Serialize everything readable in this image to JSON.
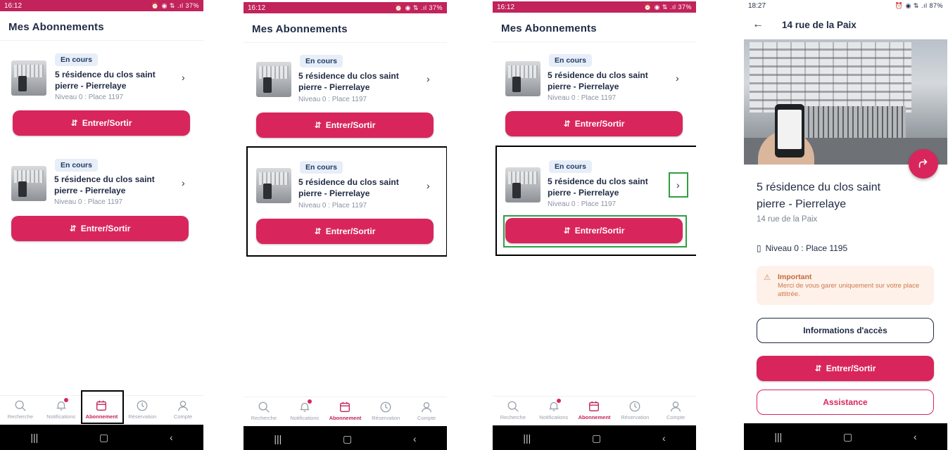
{
  "colors": {
    "brand": "#c1235a",
    "button": "#d8265c",
    "badge_bg": "#e7eef8",
    "text": "#1f2a44",
    "muted": "#8a93a3",
    "warning_bg": "#fdf1ea",
    "highlight_green": "#2f9e44"
  },
  "status_bars": [
    {
      "time": "16:12",
      "battery": "37%"
    },
    {
      "time": "16:12",
      "battery": "37%"
    },
    {
      "time": "16:12",
      "battery": "37%"
    },
    {
      "time": "18:27",
      "battery": "87%"
    }
  ],
  "list_screen": {
    "title": "Mes Abonnements",
    "subscriptions": [
      {
        "status": "En cours",
        "address_line1": "5 résidence du clos saint",
        "address_line2": "pierre - Pierrelaye",
        "place": "Niveau 0 : Place 1197",
        "action": "Entrer/Sortir"
      },
      {
        "status": "En cours",
        "address_line1": "5 résidence du clos saint",
        "address_line2": "pierre - Pierrelaye",
        "place": "Niveau 0 : Place 1197",
        "action": "Entrer/Sortir"
      }
    ]
  },
  "bottom_nav": [
    {
      "label": "Recherche",
      "icon": "search-icon"
    },
    {
      "label": "Notifications",
      "icon": "bell-icon",
      "dot": true
    },
    {
      "label": "Abonnement",
      "icon": "calendar-icon",
      "active": true
    },
    {
      "label": "Réservation",
      "icon": "clock-icon"
    },
    {
      "label": "Compte",
      "icon": "user-icon"
    }
  ],
  "detail_screen": {
    "header_title": "14 rue de la Paix",
    "address_line1": "5 résidence du clos saint",
    "address_line2": "pierre - Pierrelaye",
    "subtitle": "14 rue de la Paix",
    "place": "Niveau 0 : Place 1195",
    "alert_title": "Important",
    "alert_text": "Merci de vous garer uniquement sur votre place attitrée.",
    "access_info_button": "Informations d'accès",
    "enter_exit_button": "Entrer/Sortir",
    "assistance_button": "Assistance"
  }
}
